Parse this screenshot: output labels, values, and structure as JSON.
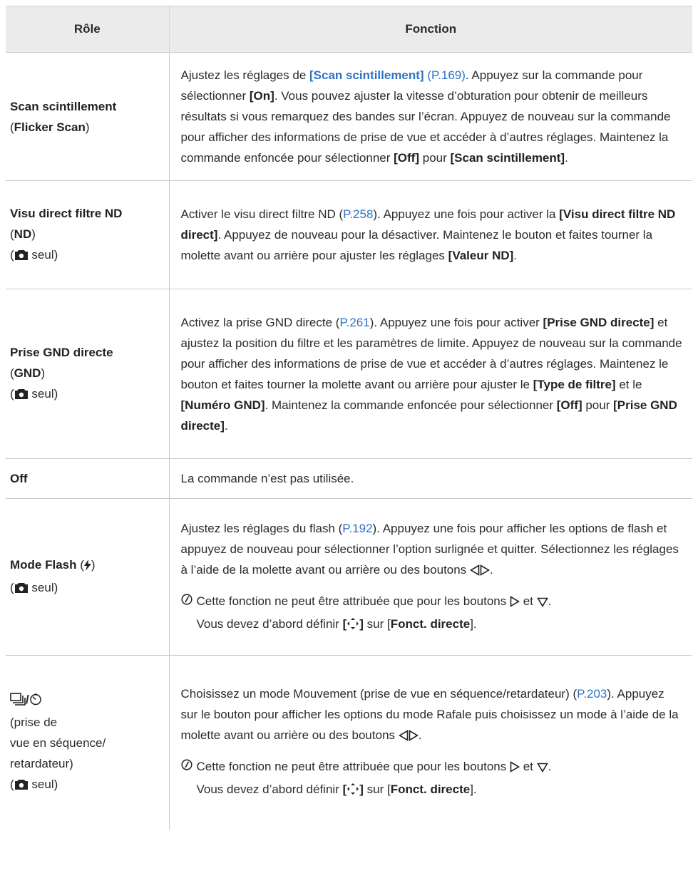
{
  "header": {
    "role": "Rôle",
    "function": "Fonction"
  },
  "rows": {
    "flicker": {
      "role_name": "Scan scintillement",
      "role_sub": "Flicker Scan",
      "t1": "Ajustez les réglages de ",
      "link_b": "[Scan scintillement]",
      "link_p": " (P.169)",
      "t2": ". Appuyez sur la commande pour sélectionner ",
      "on": "[On]",
      "t3": ". Vous pouvez ajuster la vitesse d’obturation pour obtenir de meilleurs résultats si vous remarquez des bandes sur l’écran. Appuyez de nouveau sur la commande pour afficher des informations de prise de vue et accéder à d’autres réglages. Maintenez la commande enfoncée pour sélectionner ",
      "off": "[Off]",
      "pour": " pour ",
      "scan": "[Scan scintillement]",
      "end": "."
    },
    "nd": {
      "role_name": "Visu direct filtre ND",
      "role_sub": "ND",
      "seul": "seul",
      "t1": "Activer le visu direct filtre ND (",
      "link": "P.258",
      "t2": "). Appuyez une fois pour activer la ",
      "b1": "[Visu direct filtre ND direct]",
      "t3": ". Appuyez de nouveau pour la désactiver. Maintenez le bouton et faites tourner la molette avant ou arrière pour ajuster les réglages ",
      "b2": "[Valeur ND]",
      "end": "."
    },
    "gnd": {
      "role_name": "Prise GND directe",
      "role_sub": "GND",
      "seul": "seul",
      "t1": "Activez la prise GND directe (",
      "link": "P.261",
      "t2": "). Appuyez une fois pour activer ",
      "b1": "[Prise GND directe]",
      "t3": " et ajustez la position du filtre et les paramètres de limite. Appuyez de nouveau sur la commande pour afficher des informations de prise de vue et accéder à d’autres réglages. Maintenez le bouton et faites tourner la molette avant ou arrière pour ajuster le ",
      "b2": "[Type de filtre]",
      "t4": " et le ",
      "b3": "[Numéro GND]",
      "t5": ". Maintenez la commande enfoncée pour sélectionner ",
      "b4": "[Off]",
      "t6": " pour ",
      "b5": "[Prise GND directe]",
      "end": "."
    },
    "off": {
      "role_name": "Off",
      "text": "La commande n’est pas utilisée."
    },
    "flash": {
      "role_name": "Mode Flash",
      "seul": "seul",
      "t1": "Ajustez les réglages du flash (",
      "link": "P.192",
      "t2": "). Appuyez une fois pour afficher les options de flash et appuyez de nouveau pour sélectionner l’option surlignée et quitter. Sélectionnez les réglages à l’aide de la molette avant ou arrière ou des boutons ",
      "end": ".",
      "note1": "Cette fonction ne peut être attribuée que pour les boutons ",
      "note_et": " et ",
      "note2": "Vous devez d’abord définir ",
      "note_sur": " sur [",
      "note_b": "Fonct. directe",
      "note_end": "]."
    },
    "drive": {
      "role_sub1": "(prise de",
      "role_sub2": "vue en séquence/",
      "role_sub3": "retardateur)",
      "seul": "seul",
      "t1": "Choisissez un mode Mouvement (prise de vue en séquence/retardateur) (",
      "link": "P.203",
      "t2": "). Appuyez sur le bouton pour afficher les options du mode Rafale puis choisissez un mode à l’aide de la molette avant ou arrière ou des boutons ",
      "end": ".",
      "note1": "Cette fonction ne peut être attribuée que pour les boutons ",
      "note_et": " et ",
      "note2": "Vous devez d’abord définir ",
      "note_sur": " sur [",
      "note_b": "Fonct. directe",
      "note_end": "]."
    }
  },
  "icons": [
    "camera-icon",
    "flash-icon",
    "left-arrow-icon",
    "right-arrow-icon",
    "down-arrow-icon",
    "note-icon",
    "multi-selector-icon",
    "sequential-shooting-icon",
    "self-timer-icon"
  ]
}
